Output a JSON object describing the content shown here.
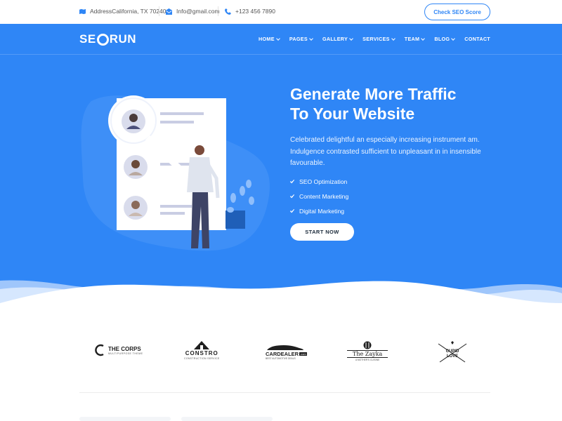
{
  "topbar": {
    "address": "AddressCalifornia, TX 70240",
    "email": "Info@gmail.com",
    "phone": "+123 456 7890",
    "check_seo_label": "Check SEO Score"
  },
  "nav": {
    "logo_left": "SE",
    "logo_right": "RUN",
    "items": [
      {
        "label": "HOME",
        "dropdown": true
      },
      {
        "label": "PAGES",
        "dropdown": true
      },
      {
        "label": "GALLERY",
        "dropdown": true
      },
      {
        "label": "SERVICES",
        "dropdown": true
      },
      {
        "label": "TEAM",
        "dropdown": true
      },
      {
        "label": "BLOG",
        "dropdown": true
      },
      {
        "label": "CONTACT",
        "dropdown": false
      }
    ]
  },
  "hero": {
    "title_line1": "Generate More Traffic",
    "title_line2": "To Your Website",
    "description": "Celebrated delightful an especially increasing instrument am. Indulgence contrasted sufficient to unpleasant in in insensible favourable.",
    "features": [
      "SEO Optimization",
      "Content Marketing",
      "Digital Marketing"
    ],
    "start_label": "START NOW"
  },
  "brands": {
    "corps_name": "THE CORPS",
    "corps_tag": "MULTIPURPOSE THEME",
    "constro_name": "CONSTRO",
    "constro_tag": "CONSTRUCTION SERVICE",
    "cardealer_name": "CARDEALER",
    "cardealer_suffix": ".com",
    "cardealer_tag": "BEST AUTOMOTIVE DEALS",
    "zayka_name": "The Zayka",
    "zayka_tag": "A MOTHER'S CUISINE",
    "cupid_line1": "CUPID",
    "cupid_line2": "LOVE"
  },
  "colors": {
    "primary": "#2f86f6",
    "white": "#ffffff",
    "dark": "#1b2a3a"
  }
}
